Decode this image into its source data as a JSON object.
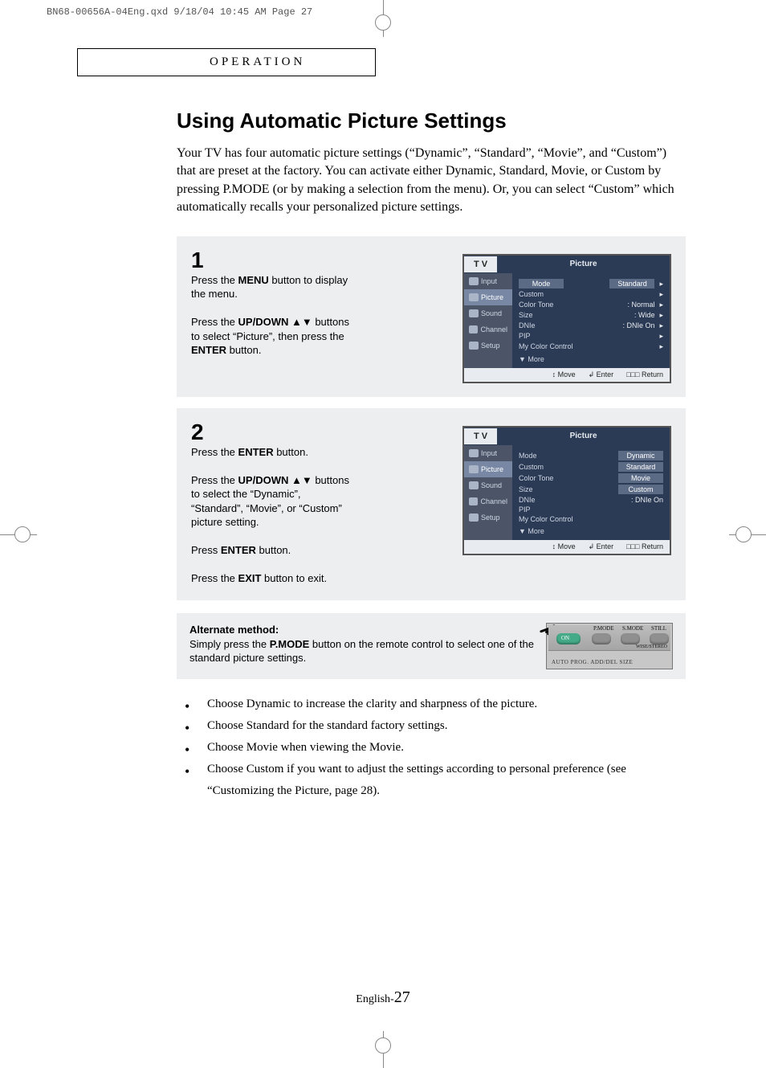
{
  "print_header": "BN68-00656A-04Eng.qxd  9/18/04 10:45 AM  Page 27",
  "operation_label": "OPERATION",
  "title": "Using Automatic Picture Settings",
  "intro": "Your TV has four automatic picture settings (“Dynamic”, “Standard”, “Movie”, and “Custom”) that are preset at the factory. You can activate either Dynamic, Standard, Movie, or Custom by pressing P.MODE (or by making a selection from the menu). Or, you can select “Custom” which automatically recalls your personalized picture settings.",
  "step1": {
    "num": "1",
    "line1a": "Press the ",
    "line1b": "MENU",
    "line1c": " button to display the menu.",
    "line2a": "Press the ",
    "line2b": "UP/DOWN",
    "line2c": " ▲▼ buttons to select “Picture”, then press the ",
    "line2d": "ENTER",
    "line2e": " button."
  },
  "step2": {
    "num": "2",
    "l1a": "Press the ",
    "l1b": "ENTER",
    "l1c": " button.",
    "l2a": "Press the ",
    "l2b": "UP/DOWN",
    "l2c": " ▲▼ buttons to select the “Dynamic”, “Standard”, “Movie”, or “Custom” picture setting.",
    "l3a": "Press ",
    "l3b": "ENTER",
    "l3c": " button.",
    "l4a": "Press the ",
    "l4b": "EXIT",
    "l4c": " button to exit."
  },
  "osd1": {
    "tv": "T V",
    "title": "Picture",
    "nav": [
      "Input",
      "Picture",
      "Sound",
      "Channel",
      "Setup"
    ],
    "rows": [
      {
        "k": "Mode",
        "v": "Standard",
        "sel": true,
        "arrow": true
      },
      {
        "k": "Custom",
        "v": "",
        "arrow": true
      },
      {
        "k": "Color Tone",
        "v": ": Normal",
        "arrow": true
      },
      {
        "k": "Size",
        "v": ": Wide",
        "arrow": true
      },
      {
        "k": "DNIe",
        "v": ": DNIe On",
        "arrow": true
      },
      {
        "k": "PIP",
        "v": "",
        "arrow": true
      },
      {
        "k": "My Color Control",
        "v": "",
        "arrow": true
      }
    ],
    "more": "▼ More",
    "footer": [
      "↕ Move",
      "↲ Enter",
      "□□□ Return"
    ]
  },
  "osd2": {
    "tv": "T V",
    "title": "Picture",
    "nav": [
      "Input",
      "Picture",
      "Sound",
      "Channel",
      "Setup"
    ],
    "rows": [
      {
        "k": "Mode",
        "v": "Dynamic",
        "sel": true
      },
      {
        "k": "Custom",
        "v": "Standard",
        "sel": true
      },
      {
        "k": "Color Tone",
        "v": "Movie",
        "sel": true
      },
      {
        "k": "Size",
        "v": "Custom",
        "sel": true
      },
      {
        "k": "DNIe",
        "v": ": DNIe On"
      },
      {
        "k": "PIP",
        "v": ""
      },
      {
        "k": "My Color Control",
        "v": ""
      }
    ],
    "more": "▼ More",
    "footer": [
      "↕ Move",
      "↲ Enter",
      "□□□ Return"
    ]
  },
  "alt": {
    "heading": "Alternate method:",
    "body_a": "Simply press the ",
    "body_b": "P.MODE",
    "body_c": " button on the remote control to select one of the standard picture settings."
  },
  "remote": {
    "labels": [
      "P.MODE",
      "S.MODE",
      "STILL",
      "ON",
      "WISE/STEREO"
    ],
    "bottom": "AUTO PROG.  ADD/DEL   SIZE"
  },
  "bullets": [
    "Choose Dynamic to increase the clarity and sharpness of the picture.",
    "Choose Standard for the standard factory settings.",
    "Choose Movie when viewing the Movie.",
    "Choose Custom if you want to adjust the settings according to personal preference (see “Customizing the Picture, page 28)."
  ],
  "footer": {
    "lang": "English-",
    "page": "27"
  }
}
